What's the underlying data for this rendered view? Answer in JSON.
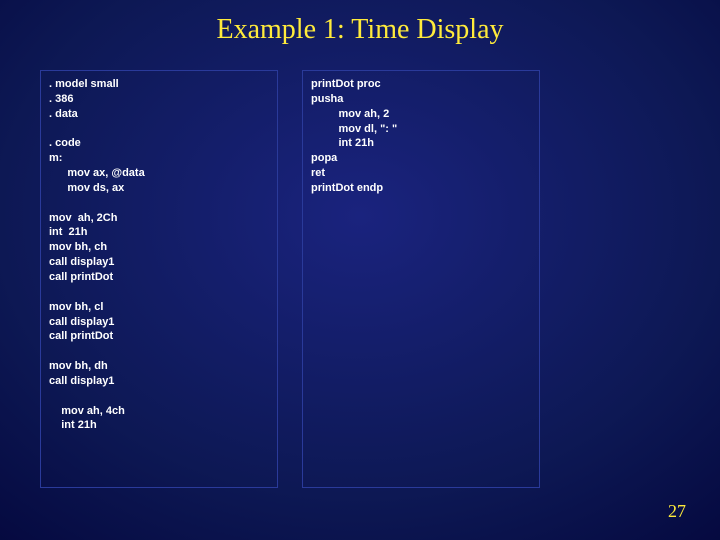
{
  "title": "Example 1: Time Display",
  "page_number": "27",
  "code_left": ". model small\n. 386\n. data\n\n. code\nm:\n      mov ax, @data\n      mov ds, ax\n\nmov  ah, 2Ch\nint  21h\nmov bh, ch\ncall display1\ncall printDot\n\nmov bh, cl\ncall display1\ncall printDot\n\nmov bh, dh\ncall display1\n\n    mov ah, 4ch\n    int 21h",
  "code_right": "printDot proc\npusha\n         mov ah, 2\n         mov dl, \": \"\n         int 21h\npopa\nret\nprintDot endp"
}
